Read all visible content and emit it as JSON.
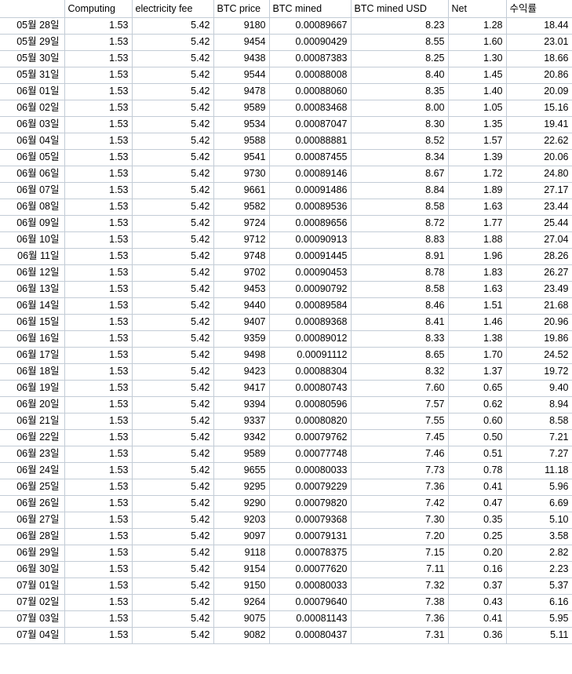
{
  "spreadsheet": {
    "corner_label": "",
    "columns": [
      {
        "key": "date",
        "label": ""
      },
      {
        "key": "comp",
        "label": "Computing"
      },
      {
        "key": "elec",
        "label": "electricity fee"
      },
      {
        "key": "price",
        "label": "BTC price"
      },
      {
        "key": "mined",
        "label": "BTC mined"
      },
      {
        "key": "usd",
        "label": "BTC mined USD"
      },
      {
        "key": "net",
        "label": "Net"
      },
      {
        "key": "rate",
        "label": "수익률"
      }
    ],
    "rows": [
      {
        "date": "05월 28일",
        "comp": "1.53",
        "elec": "5.42",
        "price": "9180",
        "mined": "0.00089667",
        "usd": "8.23",
        "net": "1.28",
        "rate": "18.44"
      },
      {
        "date": "05월 29일",
        "comp": "1.53",
        "elec": "5.42",
        "price": "9454",
        "mined": "0.00090429",
        "usd": "8.55",
        "net": "1.60",
        "rate": "23.01"
      },
      {
        "date": "05월 30일",
        "comp": "1.53",
        "elec": "5.42",
        "price": "9438",
        "mined": "0.00087383",
        "usd": "8.25",
        "net": "1.30",
        "rate": "18.66"
      },
      {
        "date": "05월 31일",
        "comp": "1.53",
        "elec": "5.42",
        "price": "9544",
        "mined": "0.00088008",
        "usd": "8.40",
        "net": "1.45",
        "rate": "20.86"
      },
      {
        "date": "06월 01일",
        "comp": "1.53",
        "elec": "5.42",
        "price": "9478",
        "mined": "0.00088060",
        "usd": "8.35",
        "net": "1.40",
        "rate": "20.09"
      },
      {
        "date": "06월 02일",
        "comp": "1.53",
        "elec": "5.42",
        "price": "9589",
        "mined": "0.00083468",
        "usd": "8.00",
        "net": "1.05",
        "rate": "15.16"
      },
      {
        "date": "06월 03일",
        "comp": "1.53",
        "elec": "5.42",
        "price": "9534",
        "mined": "0.00087047",
        "usd": "8.30",
        "net": "1.35",
        "rate": "19.41"
      },
      {
        "date": "06월 04일",
        "comp": "1.53",
        "elec": "5.42",
        "price": "9588",
        "mined": "0.00088881",
        "usd": "8.52",
        "net": "1.57",
        "rate": "22.62"
      },
      {
        "date": "06월 05일",
        "comp": "1.53",
        "elec": "5.42",
        "price": "9541",
        "mined": "0.00087455",
        "usd": "8.34",
        "net": "1.39",
        "rate": "20.06"
      },
      {
        "date": "06월 06일",
        "comp": "1.53",
        "elec": "5.42",
        "price": "9730",
        "mined": "0.00089146",
        "usd": "8.67",
        "net": "1.72",
        "rate": "24.80"
      },
      {
        "date": "06월 07일",
        "comp": "1.53",
        "elec": "5.42",
        "price": "9661",
        "mined": "0.00091486",
        "usd": "8.84",
        "net": "1.89",
        "rate": "27.17"
      },
      {
        "date": "06월 08일",
        "comp": "1.53",
        "elec": "5.42",
        "price": "9582",
        "mined": "0.00089536",
        "usd": "8.58",
        "net": "1.63",
        "rate": "23.44"
      },
      {
        "date": "06월 09일",
        "comp": "1.53",
        "elec": "5.42",
        "price": "9724",
        "mined": "0.00089656",
        "usd": "8.72",
        "net": "1.77",
        "rate": "25.44"
      },
      {
        "date": "06월 10일",
        "comp": "1.53",
        "elec": "5.42",
        "price": "9712",
        "mined": "0.00090913",
        "usd": "8.83",
        "net": "1.88",
        "rate": "27.04"
      },
      {
        "date": "06월 11일",
        "comp": "1.53",
        "elec": "5.42",
        "price": "9748",
        "mined": "0.00091445",
        "usd": "8.91",
        "net": "1.96",
        "rate": "28.26"
      },
      {
        "date": "06월 12일",
        "comp": "1.53",
        "elec": "5.42",
        "price": "9702",
        "mined": "0.00090453",
        "usd": "8.78",
        "net": "1.83",
        "rate": "26.27"
      },
      {
        "date": "06월 13일",
        "comp": "1.53",
        "elec": "5.42",
        "price": "9453",
        "mined": "0.00090792",
        "usd": "8.58",
        "net": "1.63",
        "rate": "23.49"
      },
      {
        "date": "06월 14일",
        "comp": "1.53",
        "elec": "5.42",
        "price": "9440",
        "mined": "0.00089584",
        "usd": "8.46",
        "net": "1.51",
        "rate": "21.68"
      },
      {
        "date": "06월 15일",
        "comp": "1.53",
        "elec": "5.42",
        "price": "9407",
        "mined": "0.00089368",
        "usd": "8.41",
        "net": "1.46",
        "rate": "20.96"
      },
      {
        "date": "06월 16일",
        "comp": "1.53",
        "elec": "5.42",
        "price": "9359",
        "mined": "0.00089012",
        "usd": "8.33",
        "net": "1.38",
        "rate": "19.86"
      },
      {
        "date": "06월 17일",
        "comp": "1.53",
        "elec": "5.42",
        "price": "9498",
        "mined": "0.00091112",
        "usd": "8.65",
        "net": "1.70",
        "rate": "24.52"
      },
      {
        "date": "06월 18일",
        "comp": "1.53",
        "elec": "5.42",
        "price": "9423",
        "mined": "0.00088304",
        "usd": "8.32",
        "net": "1.37",
        "rate": "19.72"
      },
      {
        "date": "06월 19일",
        "comp": "1.53",
        "elec": "5.42",
        "price": "9417",
        "mined": "0.00080743",
        "usd": "7.60",
        "net": "0.65",
        "rate": "9.40"
      },
      {
        "date": "06월 20일",
        "comp": "1.53",
        "elec": "5.42",
        "price": "9394",
        "mined": "0.00080596",
        "usd": "7.57",
        "net": "0.62",
        "rate": "8.94"
      },
      {
        "date": "06월 21일",
        "comp": "1.53",
        "elec": "5.42",
        "price": "9337",
        "mined": "0.00080820",
        "usd": "7.55",
        "net": "0.60",
        "rate": "8.58"
      },
      {
        "date": "06월 22일",
        "comp": "1.53",
        "elec": "5.42",
        "price": "9342",
        "mined": "0.00079762",
        "usd": "7.45",
        "net": "0.50",
        "rate": "7.21"
      },
      {
        "date": "06월 23일",
        "comp": "1.53",
        "elec": "5.42",
        "price": "9589",
        "mined": "0.00077748",
        "usd": "7.46",
        "net": "0.51",
        "rate": "7.27"
      },
      {
        "date": "06월 24일",
        "comp": "1.53",
        "elec": "5.42",
        "price": "9655",
        "mined": "0.00080033",
        "usd": "7.73",
        "net": "0.78",
        "rate": "11.18"
      },
      {
        "date": "06월 25일",
        "comp": "1.53",
        "elec": "5.42",
        "price": "9295",
        "mined": "0.00079229",
        "usd": "7.36",
        "net": "0.41",
        "rate": "5.96"
      },
      {
        "date": "06월 26일",
        "comp": "1.53",
        "elec": "5.42",
        "price": "9290",
        "mined": "0.00079820",
        "usd": "7.42",
        "net": "0.47",
        "rate": "6.69"
      },
      {
        "date": "06월 27일",
        "comp": "1.53",
        "elec": "5.42",
        "price": "9203",
        "mined": "0.00079368",
        "usd": "7.30",
        "net": "0.35",
        "rate": "5.10"
      },
      {
        "date": "06월 28일",
        "comp": "1.53",
        "elec": "5.42",
        "price": "9097",
        "mined": "0.00079131",
        "usd": "7.20",
        "net": "0.25",
        "rate": "3.58"
      },
      {
        "date": "06월 29일",
        "comp": "1.53",
        "elec": "5.42",
        "price": "9118",
        "mined": "0.00078375",
        "usd": "7.15",
        "net": "0.20",
        "rate": "2.82"
      },
      {
        "date": "06월 30일",
        "comp": "1.53",
        "elec": "5.42",
        "price": "9154",
        "mined": "0.00077620",
        "usd": "7.11",
        "net": "0.16",
        "rate": "2.23"
      },
      {
        "date": "07월 01일",
        "comp": "1.53",
        "elec": "5.42",
        "price": "9150",
        "mined": "0.00080033",
        "usd": "7.32",
        "net": "0.37",
        "rate": "5.37"
      },
      {
        "date": "07월 02일",
        "comp": "1.53",
        "elec": "5.42",
        "price": "9264",
        "mined": "0.00079640",
        "usd": "7.38",
        "net": "0.43",
        "rate": "6.16"
      },
      {
        "date": "07월 03일",
        "comp": "1.53",
        "elec": "5.42",
        "price": "9075",
        "mined": "0.00081143",
        "usd": "7.36",
        "net": "0.41",
        "rate": "5.95"
      },
      {
        "date": "07월 04일",
        "comp": "1.53",
        "elec": "5.42",
        "price": "9082",
        "mined": "0.00080437",
        "usd": "7.31",
        "net": "0.36",
        "rate": "5.11"
      }
    ]
  }
}
